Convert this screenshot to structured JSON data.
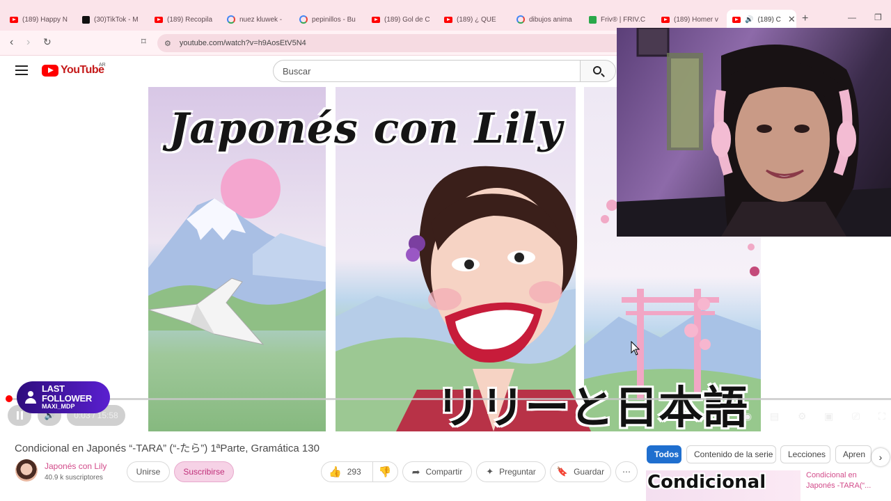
{
  "browser": {
    "tabs": [
      {
        "label": "(189) Happy N",
        "favicon": "youtube-icon"
      },
      {
        "label": "(30)TikTok - M",
        "favicon": "tiktok-icon"
      },
      {
        "label": "(189) Recopila",
        "favicon": "youtube-icon"
      },
      {
        "label": "nuez kluwek -",
        "favicon": "google-icon"
      },
      {
        "label": "pepinillos - Bu",
        "favicon": "google-icon"
      },
      {
        "label": "(189) Gol de C",
        "favicon": "youtube-icon"
      },
      {
        "label": "(189) ¿ QUE",
        "favicon": "youtube-icon"
      },
      {
        "label": "dibujos anima",
        "favicon": "google-icon"
      },
      {
        "label": "Friv® | FRIV.C",
        "favicon": "friv-icon"
      },
      {
        "label": "(189) Homer v",
        "favicon": "youtube-icon"
      },
      {
        "label": "(189) C",
        "favicon": "youtube-icon"
      }
    ],
    "url": "youtube.com/watch?v=h9AosEtV5N4"
  },
  "youtube": {
    "logo_text": "YouTube",
    "country": "AR",
    "search_placeholder": "Buscar"
  },
  "video": {
    "overlay_title": "Japonés con Lily",
    "overlay_japanese": "リリーと日本語",
    "time_current": "0:03",
    "time_total": "15:58",
    "time_display": "0:03 / 15:58",
    "progress_fraction": 0.0031
  },
  "stream_overlay": {
    "heading": "LAST FOLLOWER",
    "name": "MAXI_MDP"
  },
  "meta": {
    "title": "Condicional en Japonés “-TARA” (“-たら”) 1ªParte, Gramática 130",
    "channel": "Japonés con Lily",
    "subscribers": "40.9 k suscriptores",
    "join_label": "Unirse",
    "subscribe_label": "Suscribirse",
    "likes": "293",
    "share_label": "Compartir",
    "ask_label": "Preguntar",
    "save_label": "Guardar"
  },
  "chips": [
    "Todos",
    "Contenido de la serie",
    "Lecciones",
    "Apren"
  ],
  "related": {
    "thumb_text": "Condicional",
    "title": "Condicional en Japonés -TARA(“..."
  },
  "colors": {
    "accent_pink": "#d24b8a",
    "youtube_red": "#ff0000",
    "chip_active": "#1f6fcf"
  }
}
